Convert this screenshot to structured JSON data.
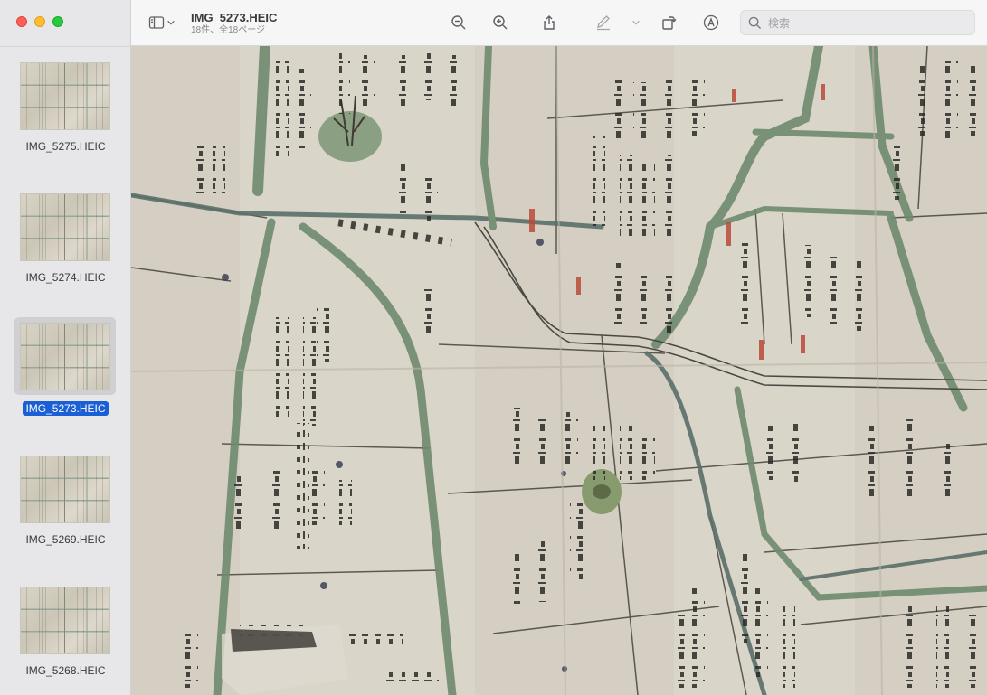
{
  "window": {
    "title": "IMG_5273.HEIC",
    "subtitle": "18件、全18ページ"
  },
  "search": {
    "placeholder": "検索"
  },
  "sidebar": {
    "items": [
      {
        "label": "IMG_5275.HEIC",
        "selected": false
      },
      {
        "label": "IMG_5274.HEIC",
        "selected": false
      },
      {
        "label": "IMG_5273.HEIC",
        "selected": true
      },
      {
        "label": "IMG_5269.HEIC",
        "selected": false
      },
      {
        "label": "IMG_5268.HEIC",
        "selected": false
      }
    ]
  },
  "toolbar": {
    "icons": [
      "sidebar-toggle-icon",
      "chevron-down-icon",
      "zoom-out-icon",
      "zoom-in-icon",
      "share-icon",
      "markup-pen-icon",
      "chevron-down-icon",
      "rotate-icon",
      "annotate-icon",
      "search-icon"
    ]
  },
  "colors": {
    "selection": "#1a5fd6",
    "sidebar_bg": "#e7e7ea",
    "paper": "#d6d2c6",
    "road_green": "#6f8a6e"
  }
}
